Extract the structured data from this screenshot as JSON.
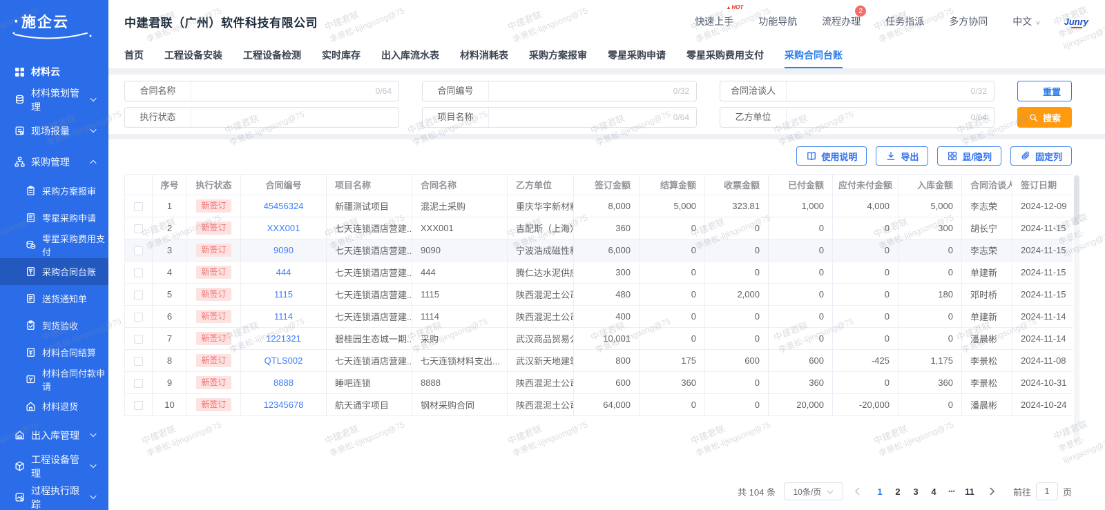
{
  "colors": {
    "primary": "#2b6de9",
    "link": "#3d7efb",
    "search_button": "#ff9a0e",
    "status_bg": "#fde2e2",
    "status_text": "#f56c6c"
  },
  "watermark": {
    "line1": "中建君联",
    "line2": "李景松-lijingsong@75"
  },
  "sidebar": {
    "logo": "施企云",
    "section": {
      "label": "材料云",
      "icon": "apps-grid-icon"
    },
    "items": [
      {
        "label": "材料策划管理",
        "icon": "database-icon",
        "expand": "down"
      },
      {
        "label": "现场报量",
        "icon": "report-icon",
        "expand": "down"
      },
      {
        "label": "采购管理",
        "icon": "org-icon",
        "expand": "up",
        "children": [
          {
            "label": "采购方案报审",
            "icon": "clipboard-icon"
          },
          {
            "label": "零星采购申请",
            "icon": "doc-icon"
          },
          {
            "label": "零星采购费用支付",
            "icon": "coins-icon"
          },
          {
            "label": "采购合同台账",
            "icon": "ledger-icon",
            "active": true
          },
          {
            "label": "送货通知单",
            "icon": "notice-icon"
          },
          {
            "label": "到货验收",
            "icon": "check-icon"
          },
          {
            "label": "材料合同结算",
            "icon": "settle-icon"
          },
          {
            "label": "材料合同付款申请",
            "icon": "payment-icon"
          },
          {
            "label": "材料退货",
            "icon": "return-icon"
          }
        ]
      },
      {
        "label": "出入库管理",
        "icon": "warehouse-icon",
        "expand": "down"
      },
      {
        "label": "工程设备管理",
        "icon": "cube-icon",
        "expand": "down"
      },
      {
        "label": "过程执行跟踪",
        "icon": "tracking-icon",
        "expand": "down"
      }
    ]
  },
  "header": {
    "company": "中建君联（广州）软件科技有限公司",
    "nav": [
      {
        "label": "快速上手",
        "tag": "HOT"
      },
      {
        "label": "功能导航"
      },
      {
        "label": "流程办理",
        "badge": "2"
      },
      {
        "label": "任务指派"
      },
      {
        "label": "多方协同"
      },
      {
        "label": "中文",
        "dropdown": true
      }
    ],
    "brand": "Junry"
  },
  "tabs": {
    "items": [
      "首页",
      "工程设备安装",
      "工程设备检测",
      "实时库存",
      "出入库流水表",
      "材料消耗表",
      "采购方案报审",
      "零星采购申请",
      "零星采购费用支付",
      "采购合同台账"
    ],
    "active": "采购合同台账"
  },
  "filters": {
    "rows": [
      [
        {
          "label": "合同名称",
          "type": "text",
          "value": "",
          "counter": "0/64"
        },
        {
          "label": "合同编号",
          "type": "text",
          "value": "",
          "counter": "0/32"
        },
        {
          "label": "合同洽谈人",
          "type": "text",
          "value": "",
          "counter": "0/32"
        }
      ],
      [
        {
          "label": "执行状态",
          "type": "select",
          "value": ""
        },
        {
          "label": "项目名称",
          "type": "text",
          "value": "",
          "counter": "0/64"
        },
        {
          "label": "乙方单位",
          "type": "text",
          "value": "",
          "counter": "0/64"
        }
      ]
    ],
    "reset_label": "重置",
    "search_label": "搜索"
  },
  "toolbar": {
    "buttons": [
      {
        "label": "使用说明",
        "icon": "book-icon"
      },
      {
        "label": "导出",
        "icon": "download-icon"
      },
      {
        "label": "显/隐列",
        "icon": "grid-columns-icon"
      },
      {
        "label": "固定列",
        "icon": "paperclip-icon"
      }
    ]
  },
  "table": {
    "columns": [
      "序号",
      "执行状态",
      "合同编号",
      "项目名称",
      "合同名称",
      "乙方单位",
      "签订金额",
      "结算金额",
      "收票金额",
      "已付金额",
      "应付未付金额",
      "入库金额",
      "合同洽谈人",
      "签订日期"
    ],
    "rows": [
      {
        "seq": "1",
        "status": "新签订",
        "contract_no": "45456324",
        "project": "新疆测试项目",
        "contract_name": "混泥土采购",
        "party_b": "重庆华宇新材料有...",
        "signed": "8,000",
        "settle": "5,000",
        "invoice": "323.81",
        "paid": "1,000",
        "unpaid": "4,000",
        "inbound": "5,000",
        "negotiator": "李志荣",
        "date": "2024-12-09"
      },
      {
        "seq": "2",
        "status": "新签订",
        "contract_no": "XXX001",
        "project": "七天连锁酒店营建...",
        "contract_name": "XXX001",
        "party_b": "吉配斯（上海）建...",
        "signed": "360",
        "settle": "0",
        "invoice": "0",
        "paid": "0",
        "unpaid": "0",
        "inbound": "300",
        "negotiator": "胡长宁",
        "date": "2024-11-15"
      },
      {
        "seq": "3",
        "status": "新签订",
        "contract_no": "9090",
        "project": "七天连锁酒店营建...",
        "contract_name": "9090",
        "party_b": "宁波浩成磁性科技...",
        "signed": "6,000",
        "settle": "0",
        "invoice": "0",
        "paid": "0",
        "unpaid": "0",
        "inbound": "0",
        "negotiator": "李志荣",
        "date": "2024-11-15",
        "highlight": true
      },
      {
        "seq": "4",
        "status": "新签订",
        "contract_no": "444",
        "project": "七天连锁酒店营建...",
        "contract_name": "444",
        "party_b": "腾仁达水泥供应商",
        "signed": "300",
        "settle": "0",
        "invoice": "0",
        "paid": "0",
        "unpaid": "0",
        "inbound": "0",
        "negotiator": "单建新",
        "date": "2024-11-15"
      },
      {
        "seq": "5",
        "status": "新签订",
        "contract_no": "1115",
        "project": "七天连锁酒店营建...",
        "contract_name": "1115",
        "party_b": "陕西混泥土公司",
        "signed": "480",
        "settle": "0",
        "invoice": "2,000",
        "paid": "0",
        "unpaid": "0",
        "inbound": "180",
        "negotiator": "邓时桥",
        "date": "2024-11-15"
      },
      {
        "seq": "6",
        "status": "新签订",
        "contract_no": "1114",
        "project": "七天连锁酒店营建...",
        "contract_name": "1114",
        "party_b": "陕西混泥土公司",
        "signed": "400",
        "settle": "0",
        "invoice": "0",
        "paid": "0",
        "unpaid": "0",
        "inbound": "0",
        "negotiator": "单建新",
        "date": "2024-11-14"
      },
      {
        "seq": "7",
        "status": "新签订",
        "contract_no": "1221321",
        "project": "碧桂园生态城一期...",
        "contract_name": "采购",
        "party_b": "武汉商品贸易公司",
        "signed": "10,001",
        "settle": "0",
        "invoice": "0",
        "paid": "0",
        "unpaid": "0",
        "inbound": "0",
        "negotiator": "潘晨彬",
        "date": "2024-11-14"
      },
      {
        "seq": "8",
        "status": "新签订",
        "contract_no": "QTLS002",
        "project": "七天连锁酒店营建...",
        "contract_name": "七天连锁材料支出...",
        "party_b": "武汉新天地建筑工...",
        "signed": "800",
        "settle": "175",
        "invoice": "600",
        "paid": "600",
        "unpaid": "-425",
        "inbound": "1,175",
        "negotiator": "李景松",
        "date": "2024-11-08"
      },
      {
        "seq": "9",
        "status": "新签订",
        "contract_no": "8888",
        "project": "睡吧连锁",
        "contract_name": "8888",
        "party_b": "陕西混泥土公司",
        "signed": "600",
        "settle": "360",
        "invoice": "0",
        "paid": "360",
        "unpaid": "0",
        "inbound": "360",
        "negotiator": "李景松",
        "date": "2024-10-31"
      },
      {
        "seq": "10",
        "status": "新签订",
        "contract_no": "12345678",
        "project": "航天通宇项目",
        "contract_name": "钢材采购合同",
        "party_b": "陕西混泥土公司",
        "signed": "64,000",
        "settle": "0",
        "invoice": "0",
        "paid": "20,000",
        "unpaid": "-20,000",
        "inbound": "0",
        "negotiator": "潘晨彬",
        "date": "2024-10-24"
      }
    ]
  },
  "pagination": {
    "total_label": "共 104 条",
    "page_size": "10条/页",
    "pages": [
      "1",
      "2",
      "3",
      "4",
      "...",
      "11"
    ],
    "current": "1",
    "goto_label": "前往",
    "goto_value": "1",
    "page_suffix": "页"
  }
}
